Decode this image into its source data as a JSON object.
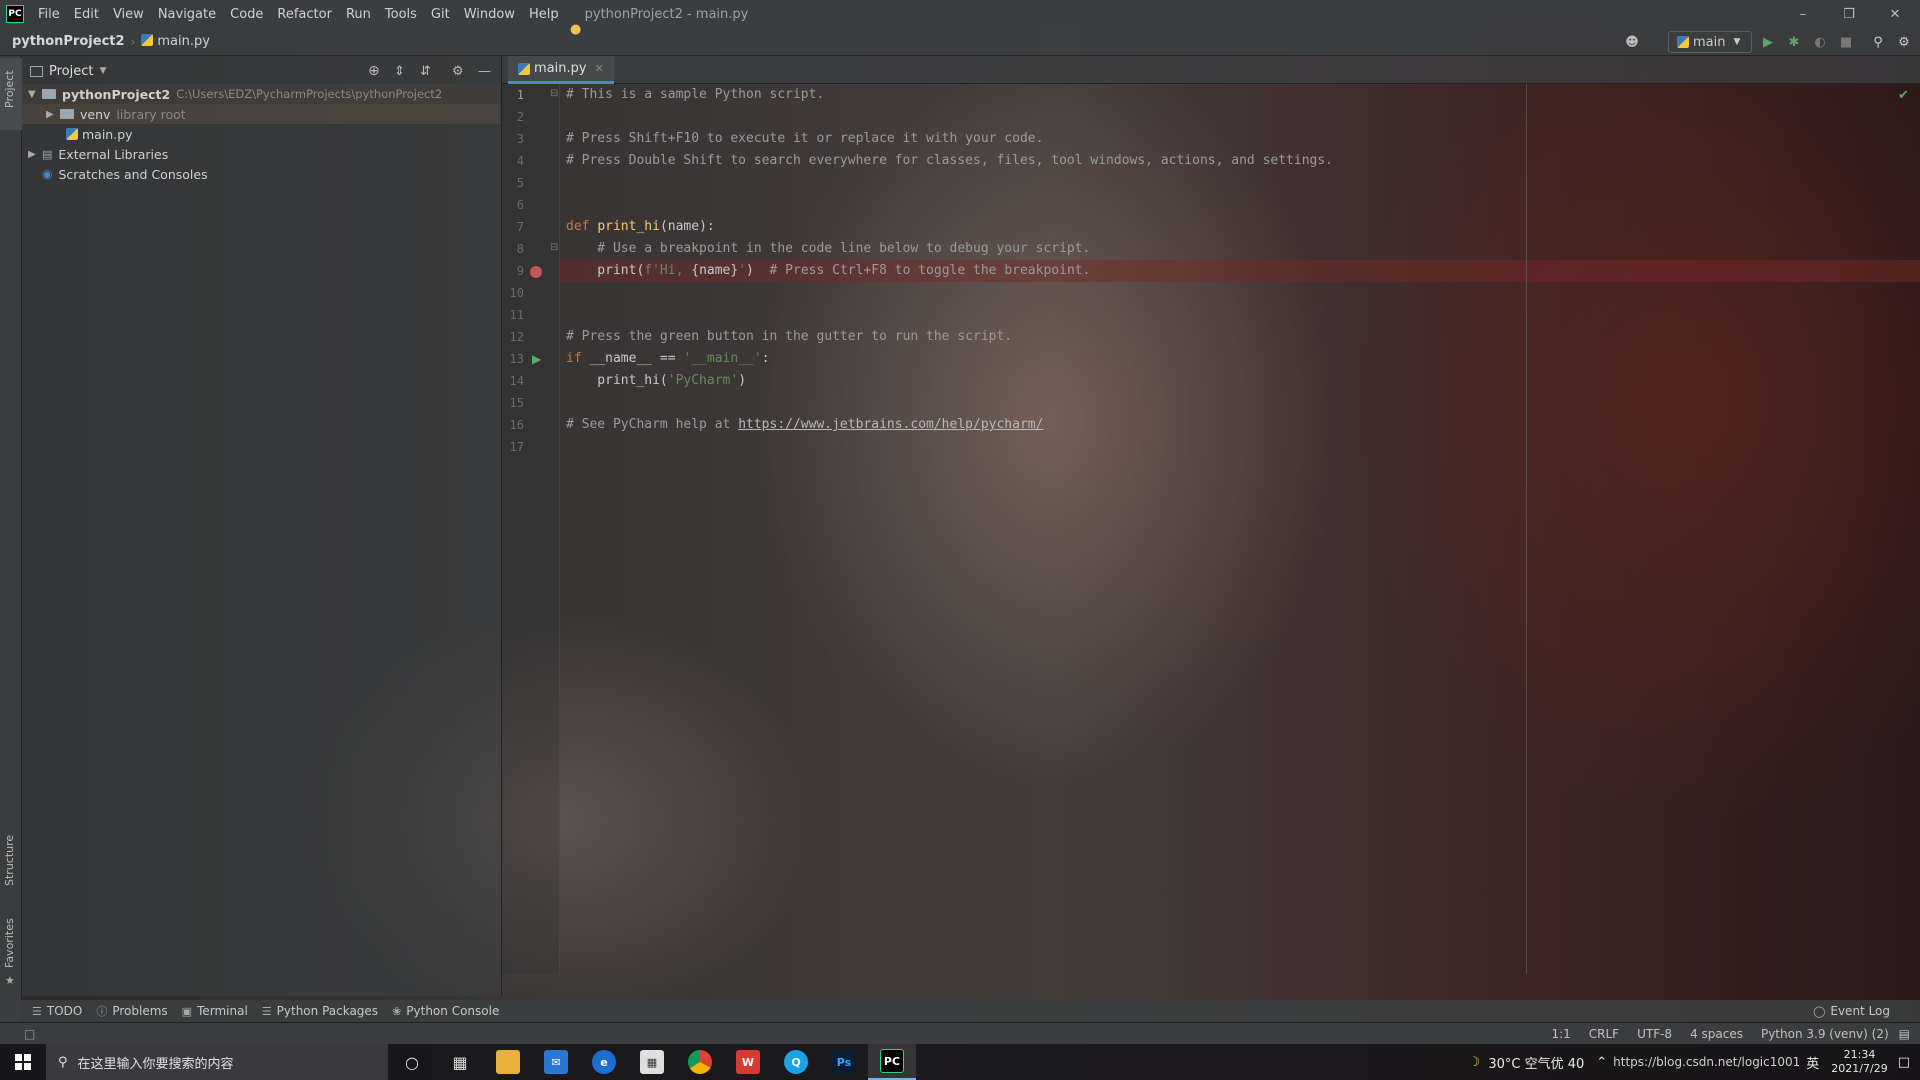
{
  "titlebar": {
    "logo": "PC",
    "menu": [
      "File",
      "Edit",
      "View",
      "Navigate",
      "Code",
      "Refactor",
      "Run",
      "Tools",
      "Git",
      "Window",
      "Help"
    ],
    "title": "pythonProject2 - main.py"
  },
  "navbar": {
    "project": "pythonProject2",
    "file": "main.py",
    "run_config": "main"
  },
  "left_strip": {
    "project": "Project",
    "structure": "Structure",
    "favorites": "Favorites"
  },
  "project_panel": {
    "header": "Project",
    "tree": {
      "root_name": "pythonProject2",
      "root_path": "C:\\Users\\EDZ\\PycharmProjects\\pythonProject2",
      "venv": "venv",
      "venv_note": "library root",
      "main_file": "main.py",
      "external": "External Libraries",
      "scratches": "Scratches and Consoles"
    }
  },
  "editor": {
    "tab": "main.py",
    "lines": [
      "1",
      "2",
      "3",
      "4",
      "5",
      "6",
      "7",
      "8",
      "9",
      "10",
      "11",
      "12",
      "13",
      "14",
      "15",
      "16",
      "17"
    ],
    "code": {
      "l1": "# This is a sample Python script.",
      "l3": "# Press Shift+F10 to execute it or replace it with your code.",
      "l4": "# Press Double Shift to search everywhere for classes, files, tool windows, actions, and settings.",
      "l7_kw": "def ",
      "l7_fn": "print_hi",
      "l7_rest": "(name):",
      "l8": "    # Use a breakpoint in the code line below to debug your script.",
      "l9_a": "    print(",
      "l9_str": "f'Hi, ",
      "l9_var": "{name}",
      "l9_str2": "'",
      "l9_b": ")",
      "l9_cm": "  # Press Ctrl+F8 to toggle the breakpoint.",
      "l12": "# Press the green button in the gutter to run the script.",
      "l13_kw": "if ",
      "l13_a": "__name__ == ",
      "l13_str": "'__main__'",
      "l13_b": ":",
      "l14_a": "    print_hi(",
      "l14_str": "'PyCharm'",
      "l14_b": ")",
      "l16_cm": "# See PyCharm help at ",
      "l16_link": "https://www.jetbrains.com/help/pycharm/"
    }
  },
  "bottom_tools": [
    "TODO",
    "Problems",
    "Terminal",
    "Python Packages",
    "Python Console"
  ],
  "event_log": "Event Log",
  "status": {
    "position": "1:1",
    "line_sep": "CRLF",
    "encoding": "UTF-8",
    "indent": "4 spaces",
    "interpreter": "Python 3.9 (venv) (2)"
  },
  "taskbar": {
    "search_placeholder": "在这里输入你要搜索的内容",
    "weather": "30°C 空气优 40",
    "tray_text": "https://blog.csdn.net/logic1001",
    "lang": "英",
    "time": "21:34",
    "date": "2021/7/29"
  },
  "colors": {
    "accent": "#4a88c7",
    "keyword": "#cc7832",
    "function": "#ffc66d",
    "string": "#6a8759",
    "breakpoint": "#c75450",
    "run": "#59a869"
  }
}
